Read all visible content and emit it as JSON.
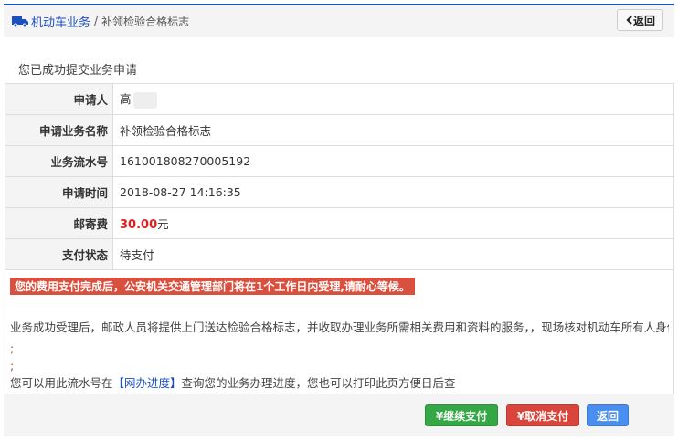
{
  "header": {
    "breadcrumb_root": "机动车业务",
    "separator": "/",
    "breadcrumb_current": "补领检验合格标志",
    "back_label": "返回",
    "root_icon": "truck-icon",
    "back_icon": "chevron-left-icon"
  },
  "title": "您已成功提交业务申请",
  "rows": [
    {
      "label": "申请人",
      "value": "高"
    },
    {
      "label": "申请业务名称",
      "value": "补领检验合格标志"
    },
    {
      "label": "业务流水号",
      "value": "161001808270005192"
    },
    {
      "label": "申请时间",
      "value": "2018-08-27 14:16:35"
    },
    {
      "label": "邮寄费",
      "value": "30.00",
      "unit": "元"
    },
    {
      "label": "支付状态",
      "value": "待支付"
    }
  ],
  "notes": {
    "alert": "您的费用支付完成后，公安机关交通管理部门将在1个工作日内受理,请耐心等候。",
    "service": "业务成功受理后，邮政人员将提供上门送达检验合格标志，并收取办理业务所需相关费用和资料的服务，，现场核对机动车所有人身份证明",
    "semi1": ";",
    "semi2": ";",
    "query_prefix": "您可以用此流水号在",
    "query_link": "【网办进度】",
    "query_suffix": "查询您的业务办理进度，您也可以打印此页方便日后查"
  },
  "footer": {
    "continue_pay": "¥继续支付",
    "cancel_pay": "¥取消支付",
    "back": "返回"
  },
  "colors": {
    "accent": "#1a4fc0",
    "fee": "#e02020",
    "alert_bg": "#d9503f",
    "continue": "#34a845",
    "cancel": "#d9453a",
    "back": "#4a8ff0"
  }
}
